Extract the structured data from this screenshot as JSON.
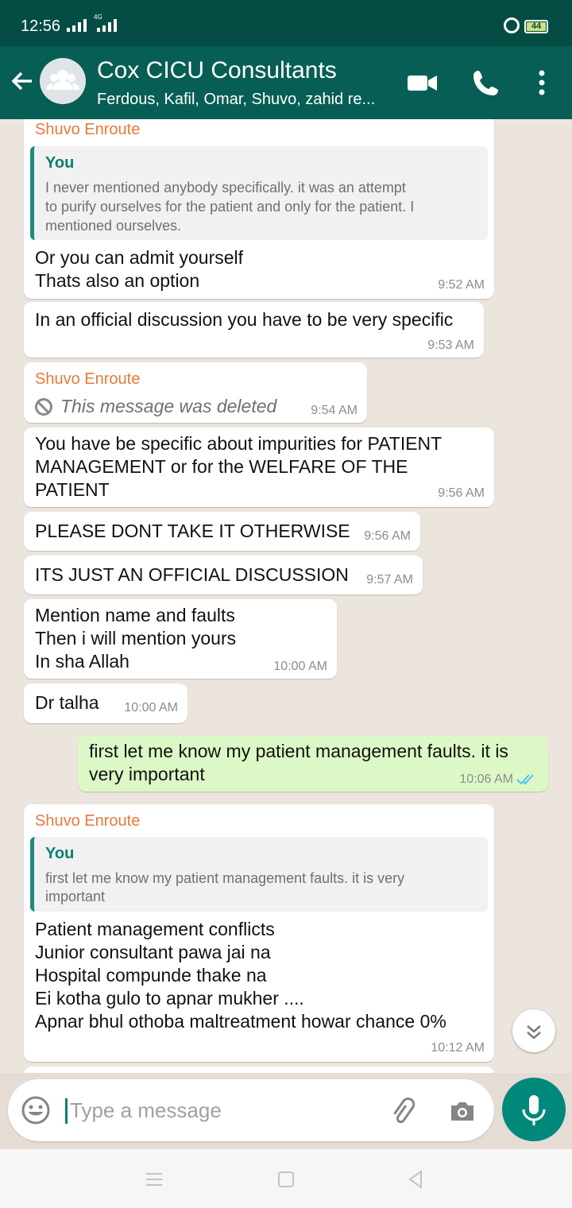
{
  "status_bar": {
    "time": "12:56",
    "network": "4G",
    "battery": "44"
  },
  "header": {
    "title": "Cox CICU Consultants",
    "subtitle": "Ferdous, Kafil, Omar, Shuvo, zahid re..."
  },
  "messages": [
    {
      "sender": "Shuvo Enroute",
      "quote_author": "You",
      "quote_lines": [
        "I never mentioned anybody specifically. it was an attempt",
        "to purify ourselves for the patient and only for the patient. I",
        "mentioned ourselves."
      ],
      "lines": [
        "Or you can admit yourself",
        "Thats also an option"
      ],
      "time": "9:52 AM"
    },
    {
      "lines": [
        "In an official discussion you have to be very specific"
      ],
      "time": "9:53 AM"
    },
    {
      "sender": "Shuvo Enroute",
      "deleted_text": "This message was deleted",
      "time": "9:54 AM"
    },
    {
      "lines": [
        "You have be specific about impurities for PATIENT",
        "MANAGEMENT or for the WELFARE OF THE",
        "PATIENT"
      ],
      "time": "9:56 AM"
    },
    {
      "lines": [
        "PLEASE DONT TAKE IT OTHERWISE"
      ],
      "time": "9:56 AM"
    },
    {
      "lines": [
        "ITS JUST AN OFFICIAL DISCUSSION"
      ],
      "time": "9:57 AM"
    },
    {
      "lines": [
        "Mention name and faults",
        "Then i will mention yours",
        "In sha Allah"
      ],
      "time": "10:00 AM"
    },
    {
      "lines": [
        "Dr talha"
      ],
      "time": "10:00 AM"
    },
    {
      "outgoing": true,
      "lines": [
        "first let me know my patient management faults. it is",
        "very important"
      ],
      "time": "10:06 AM",
      "status": "read"
    },
    {
      "sender": "Shuvo Enroute",
      "quote_author": "You",
      "quote_lines": [
        "first let me know my patient management faults. it is very",
        "important"
      ],
      "lines": [
        "Patient management conflicts",
        "Junior consultant pawa jai na",
        "Hospital compunde thake na",
        "Ei kotha gulo to apnar mukher ....",
        "Apnar bhul othoba maltreatment howar chance 0%"
      ],
      "time": "10:12 AM"
    }
  ],
  "input": {
    "placeholder": "Type a message"
  },
  "colors": {
    "header": "#075e54",
    "status_bar": "#054d44",
    "outgoing_bubble": "#dcf8c6",
    "sender_name": "#e8793a",
    "accent": "#00897b"
  }
}
